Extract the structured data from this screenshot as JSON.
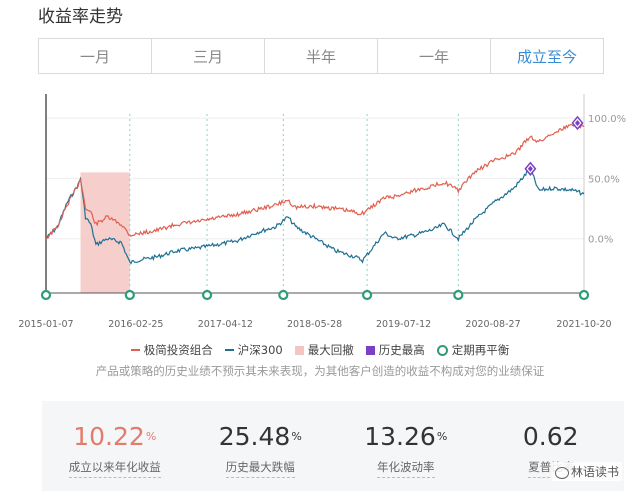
{
  "title": "收益率走势",
  "tabs": [
    "一月",
    "三月",
    "半年",
    "一年",
    "成立至今"
  ],
  "active_tab_index": 4,
  "legend": {
    "portfolio": "极简投资组合",
    "benchmark": "沪深300",
    "drawdown": "最大回撤",
    "high": "历史最高",
    "rebalance": "定期再平衡"
  },
  "disclaimer": "产品或策略的历史业绩不预示其未来表现，为其他客户创造的收益不构成对您的业绩保证",
  "stats": [
    {
      "value": "10.22",
      "unit": "%",
      "label": "成立以来年化收益"
    },
    {
      "value": "25.48",
      "unit": "%",
      "label": "历史最大跌幅"
    },
    {
      "value": "13.26",
      "unit": "%",
      "label": "年化波动率"
    },
    {
      "value": "0.62",
      "unit": "",
      "label": "夏普比率"
    }
  ],
  "watermark": "林语读书",
  "colors": {
    "portfolio": "#e06050",
    "benchmark": "#1f6f94",
    "drawdown": "#f5c5c3",
    "high": "#7b3fc6",
    "rebalance": "#2f9c78",
    "accent": "#e47b6a",
    "active_tab": "#3a8bd1"
  },
  "chart_data": {
    "type": "line",
    "x_ticks": [
      "2015-01-07",
      "2016-02-25",
      "2017-04-12",
      "2018-05-28",
      "2019-07-12",
      "2020-08-27",
      "2021-10-20"
    ],
    "y_ticks": [
      "100.0%",
      "50.0%",
      "0.0%"
    ],
    "y_tick_values": [
      100,
      50,
      0
    ],
    "ylim": [
      -45,
      120
    ],
    "series": [
      {
        "name": "极简投资组合",
        "x": [
          "2015-01-07",
          "2015-03-01",
          "2015-04-15",
          "2015-06-05",
          "2015-06-15",
          "2015-07-08",
          "2015-08-01",
          "2015-08-25",
          "2015-10-15",
          "2015-12-20",
          "2016-01-28",
          "2016-03-01",
          "2016-06-01",
          "2016-09-01",
          "2016-12-01",
          "2017-03-01",
          "2017-06-01",
          "2017-09-01",
          "2017-12-01",
          "2018-01-25",
          "2018-03-01",
          "2018-06-01",
          "2018-09-01",
          "2018-12-01",
          "2019-01-04",
          "2019-04-15",
          "2019-06-01",
          "2019-09-01",
          "2019-12-01",
          "2020-01-15",
          "2020-03-20",
          "2020-06-01",
          "2020-09-01",
          "2020-12-01",
          "2021-02-15",
          "2021-03-25",
          "2021-06-01",
          "2021-09-01",
          "2021-10-20"
        ],
        "values": [
          0,
          10,
          28,
          45,
          50,
          25,
          22,
          12,
          18,
          12,
          3,
          4,
          7,
          12,
          14,
          17,
          20,
          24,
          28,
          32,
          26,
          27,
          25,
          22,
          21,
          34,
          35,
          40,
          44,
          47,
          40,
          55,
          65,
          70,
          85,
          80,
          88,
          95,
          93
        ]
      },
      {
        "name": "沪深300",
        "x": [
          "2015-01-07",
          "2015-03-01",
          "2015-04-15",
          "2015-06-05",
          "2015-06-15",
          "2015-07-08",
          "2015-08-01",
          "2015-08-25",
          "2015-10-15",
          "2015-12-20",
          "2016-01-28",
          "2016-03-01",
          "2016-06-01",
          "2016-09-01",
          "2016-12-01",
          "2017-03-01",
          "2017-06-01",
          "2017-09-01",
          "2017-12-01",
          "2018-01-25",
          "2018-03-01",
          "2018-06-01",
          "2018-09-01",
          "2018-12-01",
          "2019-01-04",
          "2019-04-15",
          "2019-06-01",
          "2019-09-01",
          "2019-12-01",
          "2020-01-15",
          "2020-03-20",
          "2020-06-01",
          "2020-09-01",
          "2020-12-01",
          "2021-02-15",
          "2021-03-25",
          "2021-06-01",
          "2021-09-01",
          "2021-10-20"
        ],
        "values": [
          0,
          10,
          30,
          45,
          50,
          18,
          12,
          -5,
          0,
          -3,
          -20,
          -18,
          -15,
          -10,
          -8,
          -5,
          -2,
          5,
          10,
          18,
          10,
          0,
          -10,
          -15,
          -18,
          5,
          0,
          3,
          8,
          12,
          0,
          15,
          30,
          42,
          58,
          40,
          42,
          40,
          37
        ]
      }
    ],
    "drawdown_start": "2015-06-15",
    "drawdown_end": "2016-01-28",
    "historical_highs": [
      {
        "x": "2021-09-20",
        "y": 96
      },
      {
        "x": "2021-02-15",
        "y": 58
      }
    ],
    "rebalance_dates": [
      "2015-01-07",
      "2016-01-28",
      "2017-01-18",
      "2018-01-04",
      "2019-01-25",
      "2020-03-20",
      "2021-10-20"
    ],
    "grid": true
  }
}
